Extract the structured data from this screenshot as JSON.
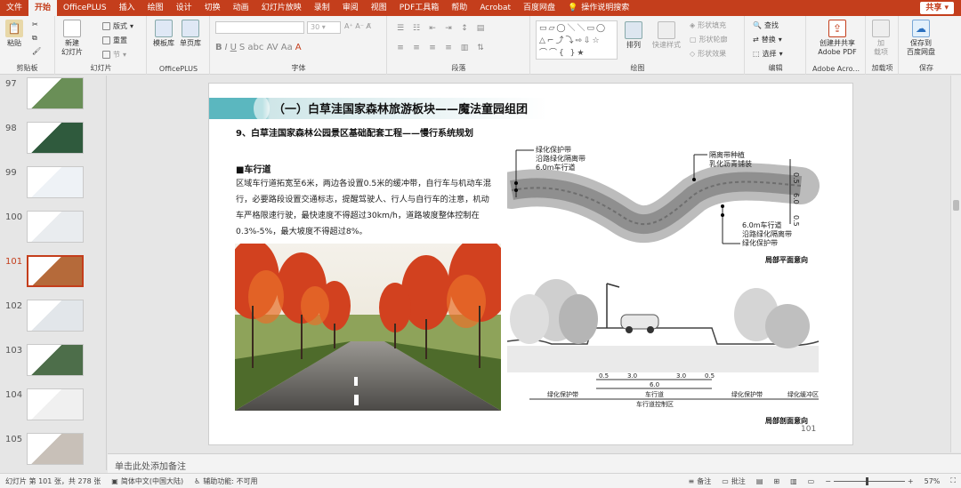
{
  "tabs": [
    "文件",
    "开始",
    "OfficePLUS",
    "插入",
    "绘图",
    "设计",
    "切换",
    "动画",
    "幻灯片放映",
    "录制",
    "审阅",
    "视图",
    "PDF工具箱",
    "帮助",
    "Acrobat",
    "百度网盘"
  ],
  "active_tab": "开始",
  "search_label": "操作说明搜索",
  "share_label": "共享",
  "ribbon": {
    "clipboard": {
      "paste": "粘贴",
      "label": "剪贴板"
    },
    "slides": {
      "new_slide": "新建\n幻灯片",
      "layout": "版式",
      "reset": "重置",
      "section": "节",
      "label": "幻灯片"
    },
    "officeplus": {
      "template": "模板库",
      "single": "单页库",
      "label": "OfficePLUS"
    },
    "font": {
      "size": "30",
      "label": "字体"
    },
    "paragraph": {
      "label": "段落"
    },
    "drawing": {
      "arrange": "排列",
      "quick_styles": "快速样式",
      "shape_fill": "形状填充",
      "shape_outline": "形状轮廓",
      "shape_effects": "形状效果",
      "label": "绘图"
    },
    "editing": {
      "find": "查找",
      "replace": "替换",
      "select": "选择",
      "label": "编辑"
    },
    "adobe": {
      "create_share": "创建并共享\nAdobe PDF",
      "label": "Adobe Acro..."
    },
    "addins": {
      "add": "加\n载项",
      "label": "加载项"
    },
    "save": {
      "save_baidu": "保存到\n百度网盘",
      "label": "保存"
    }
  },
  "thumbnails": [
    {
      "num": "97"
    },
    {
      "num": "98"
    },
    {
      "num": "99"
    },
    {
      "num": "100"
    },
    {
      "num": "101",
      "current": true
    },
    {
      "num": "102"
    },
    {
      "num": "103"
    },
    {
      "num": "104"
    },
    {
      "num": "105"
    }
  ],
  "slide": {
    "header": "（一）白草洼国家森林旅游板块——魔法童园组团",
    "subtitle": "9、白草洼国家森林公园景区基础配套工程——慢行系统规划",
    "section": "■车行道",
    "body": "区域车行道拓宽至6米，两边各设置0.5米的缓冲带，自行车与机动车混行，必要路段设置交通标志，提醒驾驶人、行人与自行车的注意，机动车严格限速行驶，最快速度不得超过30km/h，道路坡度整体控制在0.3%-5%，最大坡度不得超过8%。",
    "plan_labels": {
      "l1": "绿化保护带",
      "l2": "沿路绿化隔离带",
      "l3": "6.0m车行道",
      "r1": "隔离带种植",
      "r2": "乳化沥青铺装",
      "b1": "6.0m车行道",
      "b2": "沿路绿化隔离带",
      "b3": "绿化保护带",
      "dim_a": "0.5",
      "dim_b": "6.0",
      "dim_c": "0.5",
      "caption": "局部平面意向"
    },
    "section_labels": {
      "d1": "0.5",
      "d2": "3.0",
      "d3": "3.0",
      "d4": "0.5",
      "d5": "6.0",
      "z1": "绿化保护带",
      "z2": "车行道",
      "z3": "绿化保护带",
      "z4": "绿化缓冲区",
      "z5": "车行道控制区",
      "caption": "局部剖面意向"
    },
    "page_num": "101"
  },
  "notes_placeholder": "单击此处添加备注",
  "status": {
    "slide_info": "幻灯片 第 101 张，共 278 张",
    "language": "简体中文(中国大陆)",
    "accessibility": "辅助功能: 不可用",
    "notes": "备注",
    "comments": "批注",
    "zoom": "57%"
  },
  "colors": {
    "accent": "#c43e1c",
    "header_bar": "#5bb7bf"
  }
}
